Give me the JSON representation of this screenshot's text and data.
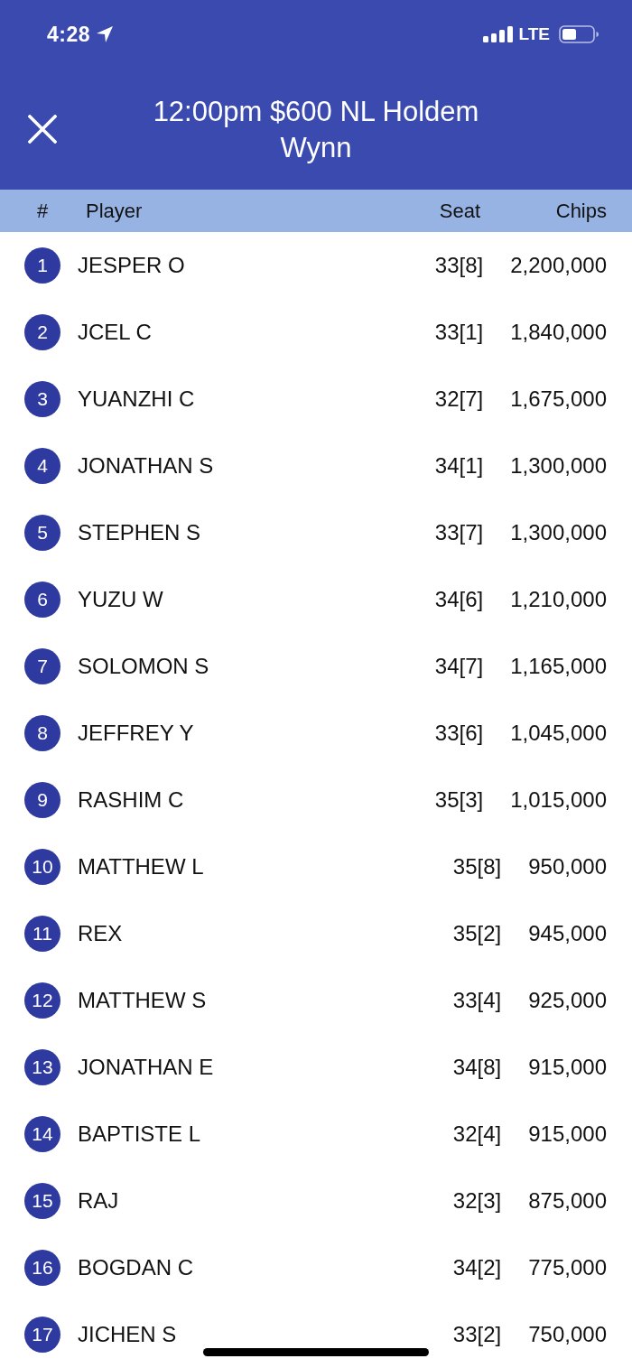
{
  "status_bar": {
    "time": "4:28",
    "network": "LTE"
  },
  "header": {
    "title": "12:00pm $600 NL Holdem",
    "subtitle": "Wynn"
  },
  "table": {
    "columns": [
      "#",
      "Player",
      "Seat",
      "Chips"
    ],
    "rows": [
      {
        "rank": "1",
        "player": "JESPER O",
        "seat": "33[8]",
        "chips": "2,200,000"
      },
      {
        "rank": "2",
        "player": "JCEL C",
        "seat": "33[1]",
        "chips": "1,840,000"
      },
      {
        "rank": "3",
        "player": "YUANZHI C",
        "seat": "32[7]",
        "chips": "1,675,000"
      },
      {
        "rank": "4",
        "player": "JONATHAN S",
        "seat": "34[1]",
        "chips": "1,300,000"
      },
      {
        "rank": "5",
        "player": "STEPHEN S",
        "seat": "33[7]",
        "chips": "1,300,000"
      },
      {
        "rank": "6",
        "player": "YUZU W",
        "seat": "34[6]",
        "chips": "1,210,000"
      },
      {
        "rank": "7",
        "player": "SOLOMON S",
        "seat": "34[7]",
        "chips": "1,165,000"
      },
      {
        "rank": "8",
        "player": "JEFFREY Y",
        "seat": "33[6]",
        "chips": "1,045,000"
      },
      {
        "rank": "9",
        "player": "RASHIM C",
        "seat": "35[3]",
        "chips": "1,015,000"
      },
      {
        "rank": "10",
        "player": "MATTHEW L",
        "seat": "35[8]",
        "chips": "950,000"
      },
      {
        "rank": "11",
        "player": "REX",
        "seat": "35[2]",
        "chips": "945,000"
      },
      {
        "rank": "12",
        "player": "MATTHEW S",
        "seat": "33[4]",
        "chips": "925,000"
      },
      {
        "rank": "13",
        "player": "JONATHAN E",
        "seat": "34[8]",
        "chips": "915,000"
      },
      {
        "rank": "14",
        "player": "BAPTISTE L",
        "seat": "32[4]",
        "chips": "915,000"
      },
      {
        "rank": "15",
        "player": "RAJ",
        "seat": "32[3]",
        "chips": "875,000"
      },
      {
        "rank": "16",
        "player": "BOGDAN C",
        "seat": "34[2]",
        "chips": "775,000"
      },
      {
        "rank": "17",
        "player": "JICHEN S",
        "seat": "33[2]",
        "chips": "750,000"
      }
    ]
  }
}
